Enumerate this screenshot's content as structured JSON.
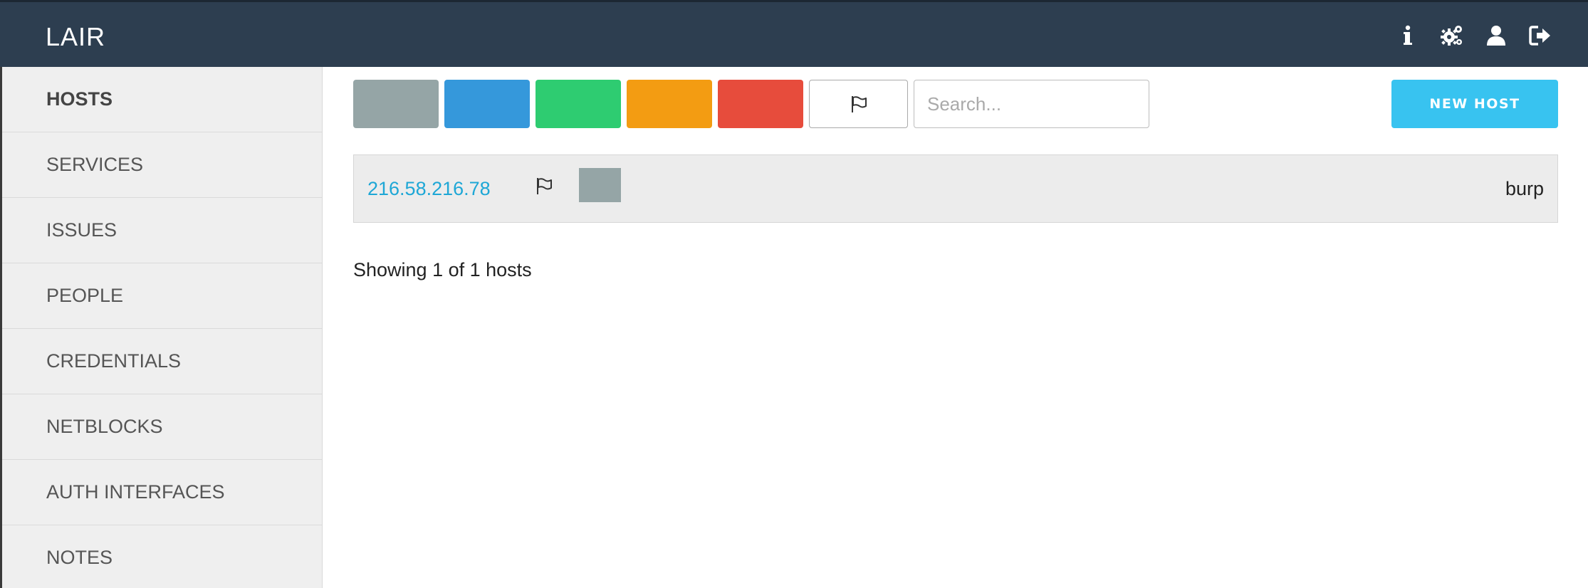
{
  "app": {
    "title": "LAIR"
  },
  "topbar": {
    "icons": [
      "info-icon",
      "gears-icon",
      "user-icon",
      "sign-out-icon"
    ]
  },
  "sidebar": {
    "items": [
      {
        "label": "HOSTS",
        "active": true
      },
      {
        "label": "SERVICES"
      },
      {
        "label": "ISSUES"
      },
      {
        "label": "PEOPLE"
      },
      {
        "label": "CREDENTIALS"
      },
      {
        "label": "NETBLOCKS"
      },
      {
        "label": "AUTH INTERFACES"
      },
      {
        "label": "NOTES"
      }
    ]
  },
  "filters": {
    "status_colors": [
      "#95a5a6",
      "#3598db",
      "#2ecc71",
      "#f39c12",
      "#e74c3c"
    ],
    "flag_icon": "flag-icon",
    "search_placeholder": "Search...",
    "search_value": ""
  },
  "actions": {
    "new_host_label": "NEW HOST"
  },
  "hosts": [
    {
      "ip": "216.58.216.78",
      "status_color": "#95a5a6",
      "tag": "burp"
    }
  ],
  "footer": {
    "showing_text": "Showing 1 of 1 hosts"
  },
  "colors": {
    "topbar": "#2d3e50",
    "accent": "#38c3f0",
    "link": "#1ea7d6"
  }
}
